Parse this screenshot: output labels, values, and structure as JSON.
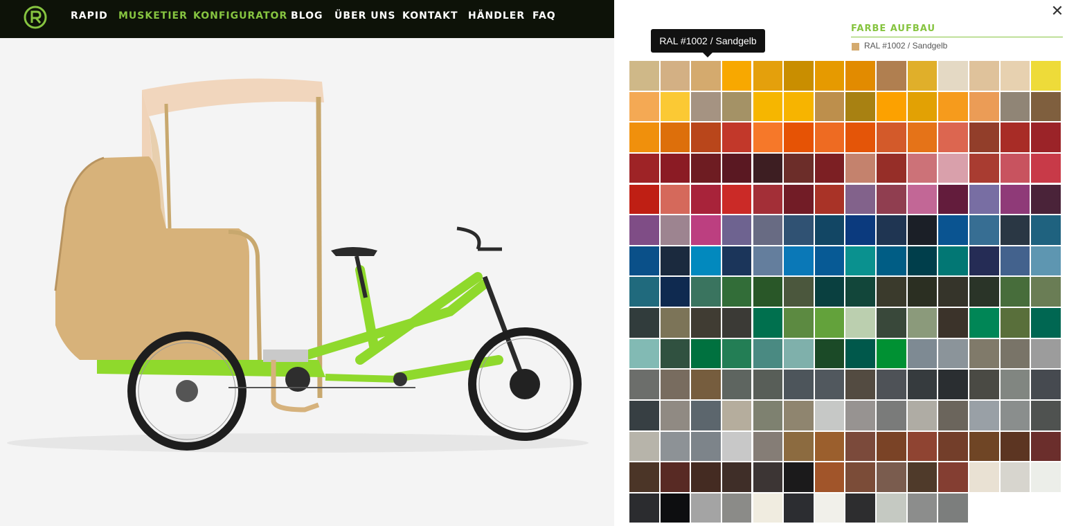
{
  "nav": {
    "items": [
      {
        "label": "RAPID",
        "active": false
      },
      {
        "label": "MUSKETIER",
        "active": true
      },
      {
        "label": "KONFIGURATOR",
        "active": true
      },
      {
        "label": "BLOG",
        "active": false
      },
      {
        "label": "ÜBER UNS",
        "active": false
      },
      {
        "label": "KONTAKT",
        "active": false
      },
      {
        "label": "HÄNDLER",
        "active": false
      },
      {
        "label": "FAQ",
        "active": false
      }
    ]
  },
  "panel": {
    "close_icon": "close-icon",
    "section_title": "FARBE AUFBAU",
    "selected": {
      "label": "RAL #1002 / Sandgelb",
      "color": "#d4aa6e"
    },
    "tooltip": "RAL #1002 / Sandgelb",
    "swatches": [
      "#cfb888",
      "#d3b084",
      "#d4aa6e",
      "#f8a800",
      "#e4a00c",
      "#c98e00",
      "#e69a00",
      "#e28b00",
      "#b07f50",
      "#e0af2a",
      "#e4d9c4",
      "#dfc29b",
      "#e7d1b0",
      "#eedb39",
      "#f4a954",
      "#fbc934",
      "#a59382",
      "#a49266",
      "#f6b600",
      "#f7b400",
      "#bd8f4c",
      "#a88112",
      "#fca100",
      "#e2a104",
      "#f69b1c",
      "#eb9c56",
      "#908576",
      "#7f5f3e",
      "#f0900c",
      "#dd6f0b",
      "#b9461b",
      "#c2382a",
      "#f67829",
      "#e65305",
      "#ee6b22",
      "#e45508",
      "#d35a2a",
      "#e57318",
      "#dc6650",
      "#923e2a",
      "#a82c26",
      "#9b2328",
      "#9e2326",
      "#8b1b24",
      "#6e1c22",
      "#5a1822",
      "#3d1e22",
      "#6c2d29",
      "#7c1f23",
      "#c4826d",
      "#962e28",
      "#cc7278",
      "#d9a0ab",
      "#a93c31",
      "#c8535f",
      "#c83a48",
      "#bf1f14",
      "#d5695b",
      "#a8233a",
      "#cb2a27",
      "#a32f37",
      "#721c26",
      "#a93327",
      "#82628b",
      "#903e50",
      "#c26796",
      "#631c3c",
      "#786ea3",
      "#8f3a78",
      "#4a2339",
      "#7f4d86",
      "#9d8490",
      "#bc3f80",
      "#6e6390",
      "#686b83",
      "#305273",
      "#124664",
      "#0b3a7e",
      "#1f3552",
      "#1b1f27",
      "#0a5491",
      "#376e93",
      "#2a3744",
      "#1f627f",
      "#0a5089",
      "#1b2a3e",
      "#0289be",
      "#1b355a",
      "#647e9d",
      "#0a78b7",
      "#075a95",
      "#0a918f",
      "#005d85",
      "#003e4b",
      "#027774",
      "#252c55",
      "#43628d",
      "#5e96b1",
      "#206a7d",
      "#0f2a50",
      "#3a745f",
      "#326d38",
      "#295728",
      "#4b573d",
      "#0a4040",
      "#12463a",
      "#3a3a2c",
      "#2b2f22",
      "#35342a",
      "#2a3428",
      "#476d3b",
      "#6a7d55",
      "#313c3c",
      "#7c7458",
      "#403c33",
      "#3b3a36",
      "#00704e",
      "#5c8a41",
      "#63a23b",
      "#bbcfaf",
      "#39483a",
      "#8b9a7b",
      "#3b332a",
      "#008656",
      "#596f3b",
      "#006752",
      "#82bab4",
      "#305140",
      "#00713f",
      "#237e55",
      "#4a8a82",
      "#7fb0ab",
      "#1b4a27",
      "#00584b",
      "#009133",
      "#7e8a93",
      "#8b949a",
      "#807a6a",
      "#797468",
      "#9c9c9c",
      "#6c6e6b",
      "#786c5f",
      "#765d3e",
      "#5e6560",
      "#585e58",
      "#4d555b",
      "#51585e",
      "#534b41",
      "#4e5257",
      "#363b3e",
      "#2a2e31",
      "#4a4a44",
      "#818681",
      "#464a50",
      "#373f43",
      "#908a83",
      "#5c666d",
      "#b5ad9d",
      "#7e8170",
      "#8f856f",
      "#c6c8c6",
      "#979391",
      "#7a7b7a",
      "#afaca4",
      "#6b655c",
      "#99a0a6",
      "#8a8e8d",
      "#4f5250",
      "#b7b4aa",
      "#8d9296",
      "#7d848a",
      "#c8c8c8",
      "#857d76",
      "#8c6b40",
      "#9b5f2d",
      "#7b4a3b",
      "#7a4326",
      "#8f4432",
      "#733e2a",
      "#6f4525",
      "#5c3522",
      "#6b2e2c",
      "#4b3527",
      "#582a24",
      "#442b22",
      "#3f2e28",
      "#3c3534",
      "#1b1a1b",
      "#a1552a",
      "#7b4c38",
      "#7a5c4e",
      "#4f3a2a",
      "#843e32",
      "#e9e1d3",
      "#d7d5ce",
      "#eceee9",
      "#2b2c2f",
      "#0d0e10",
      "#a4a4a4",
      "#8b8b88",
      "#f0ece0",
      "#2c2d31",
      "#f1f0ea",
      "#2d2d2f",
      "#c5c9c2",
      "#8c8d8c",
      "#7c7e7d"
    ]
  }
}
